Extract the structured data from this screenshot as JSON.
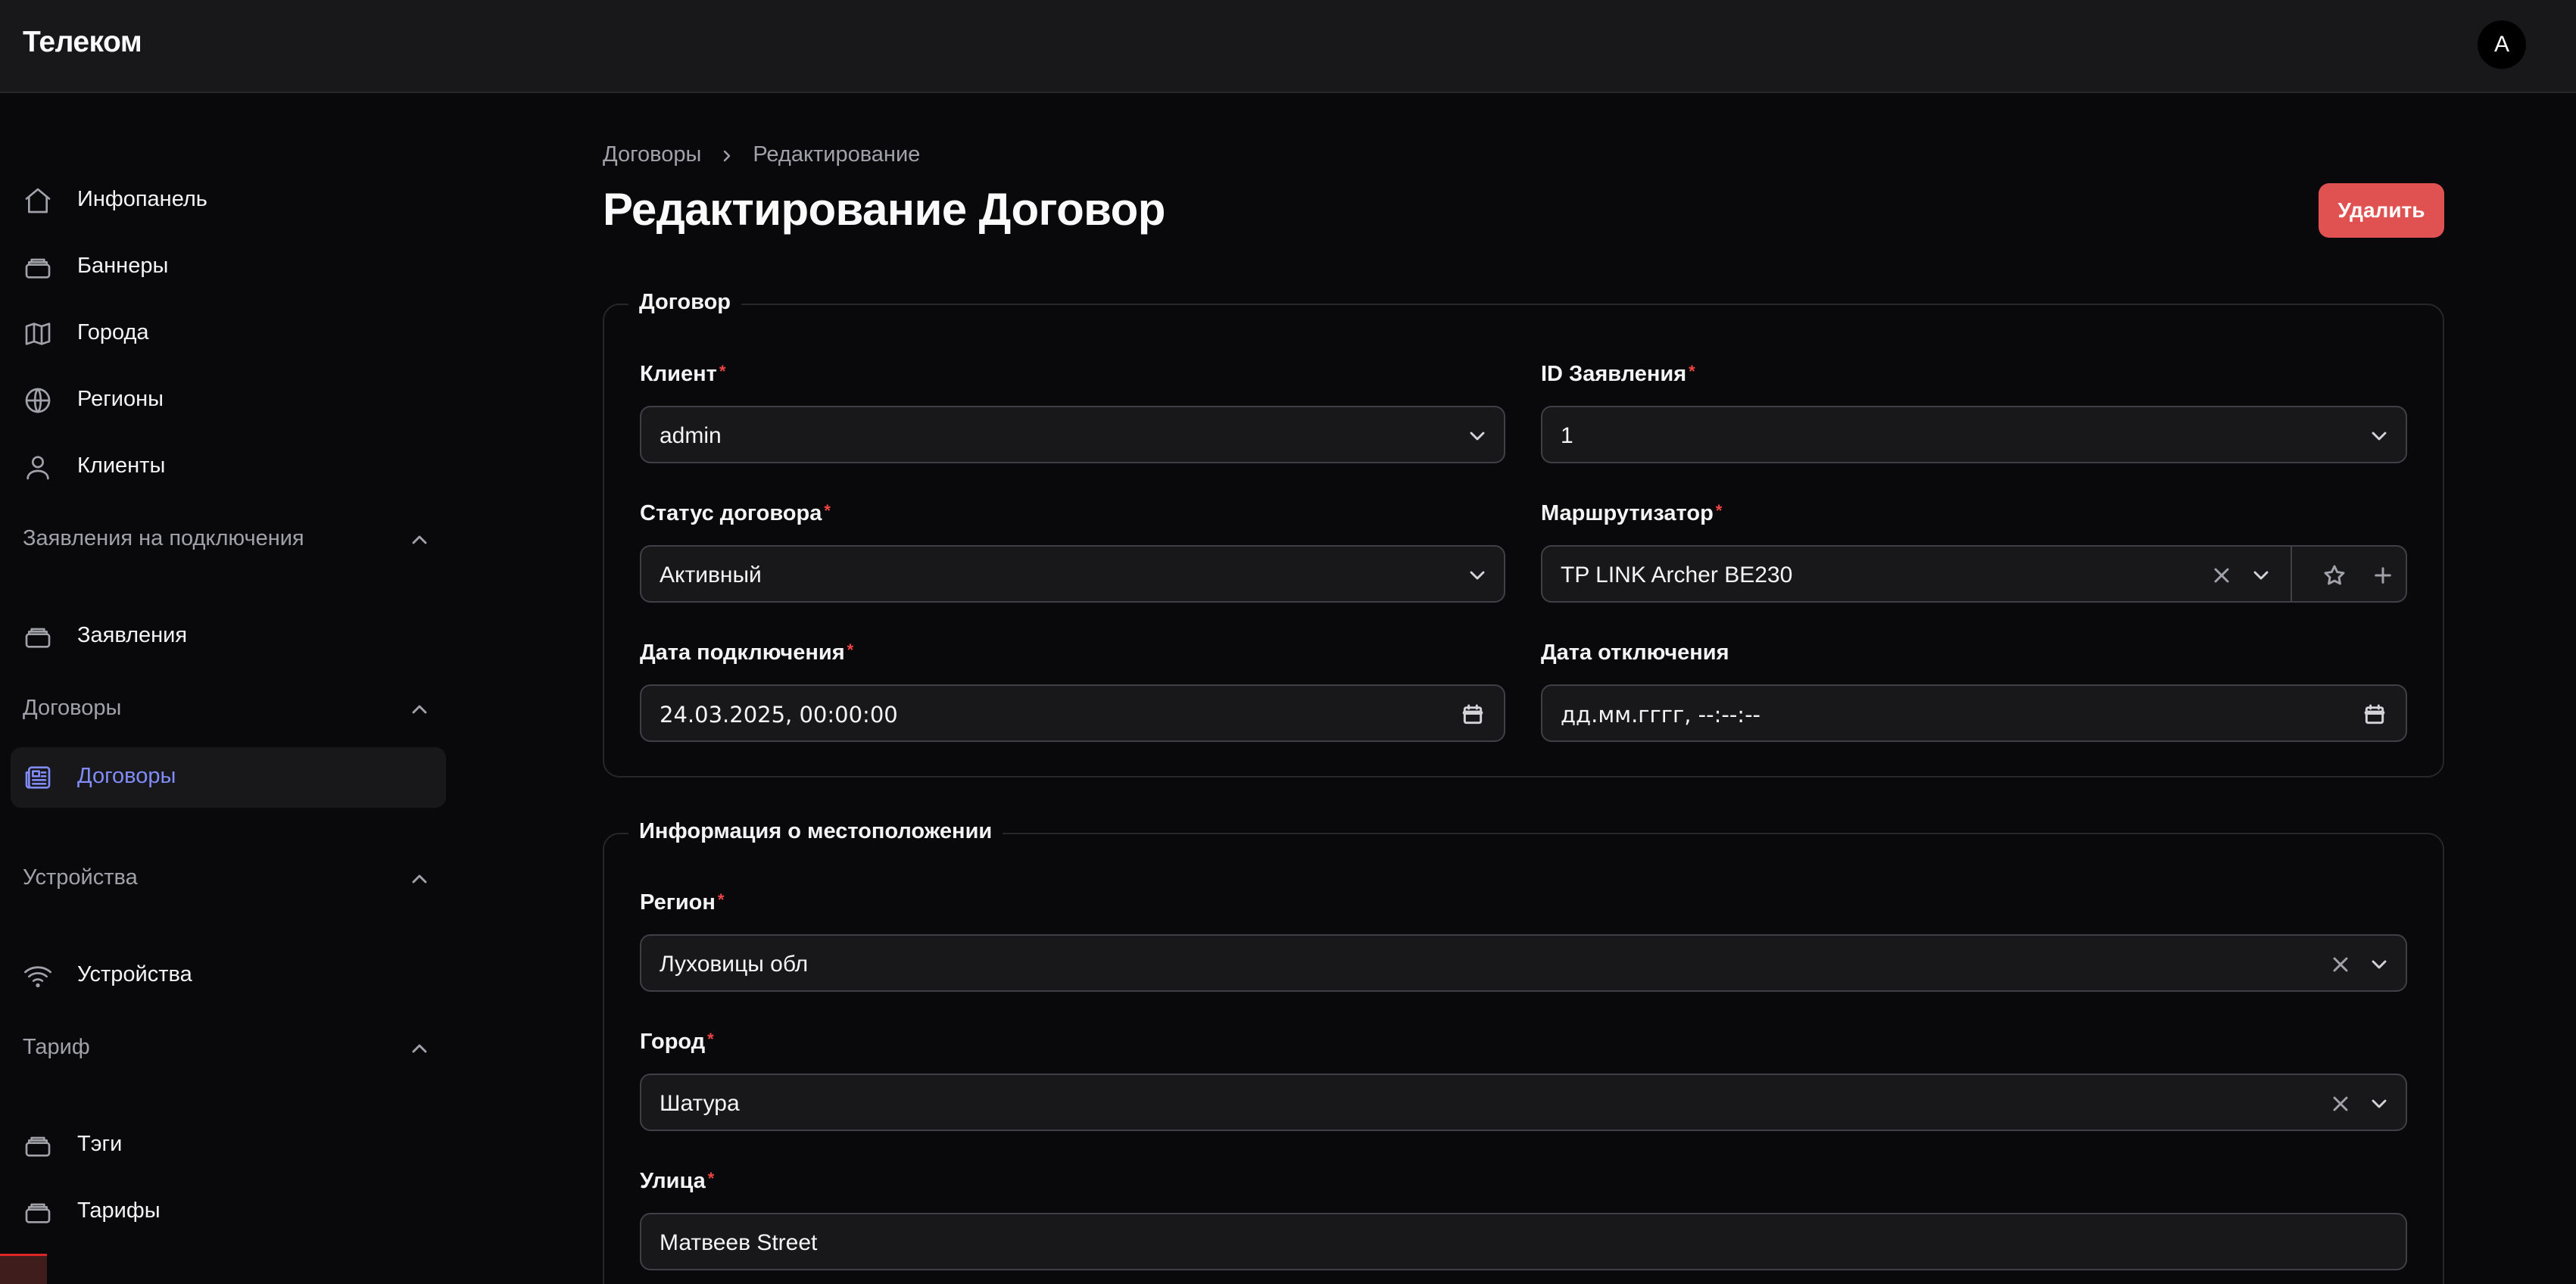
{
  "app": {
    "brand": "Телеком",
    "avatar_letter": "A"
  },
  "sidebar": {
    "items_top": [
      {
        "label": "Инфопанель",
        "icon": "home-icon"
      },
      {
        "label": "Баннеры",
        "icon": "stack-icon"
      },
      {
        "label": "Города",
        "icon": "map-icon"
      },
      {
        "label": "Регионы",
        "icon": "globe-icon"
      },
      {
        "label": "Клиенты",
        "icon": "user-icon"
      }
    ],
    "groups": [
      {
        "title": "Заявления на подключения",
        "items": [
          {
            "label": "Заявления",
            "icon": "stack-icon"
          }
        ]
      },
      {
        "title": "Договоры",
        "items": [
          {
            "label": "Договоры",
            "icon": "newspaper-icon",
            "active": true
          }
        ]
      },
      {
        "title": "Устройства",
        "items": [
          {
            "label": "Устройства",
            "icon": "wifi-icon"
          }
        ]
      },
      {
        "title": "Тариф",
        "items": [
          {
            "label": "Тэги",
            "icon": "stack-icon"
          },
          {
            "label": "Тарифы",
            "icon": "stack-icon"
          }
        ]
      }
    ]
  },
  "breadcrumb": {
    "parent": "Договоры",
    "current": "Редактирование"
  },
  "page": {
    "title": "Редактирование Договор",
    "delete_label": "Удалить"
  },
  "contract_section": {
    "legend": "Договор",
    "fields": {
      "client": {
        "label": "Клиент",
        "value": "admin"
      },
      "application_id": {
        "label": "ID Заявления",
        "value": "1"
      },
      "status": {
        "label": "Статус договора",
        "value": "Активный"
      },
      "router": {
        "label": "Маршрутизатор",
        "value": "TP LINK Archer BE230"
      },
      "connect_date": {
        "label": "Дата подключения",
        "value": "24.03.2025, 00:00:00"
      },
      "disconnect_date": {
        "label": "Дата отключения",
        "value": "дд.мм.гггг, --:--:--"
      }
    }
  },
  "location_section": {
    "legend": "Информация о местоположении",
    "fields": {
      "region": {
        "label": "Регион",
        "value": "Луховицы обл"
      },
      "city": {
        "label": "Город",
        "value": "Шатура"
      },
      "street": {
        "label": "Улица",
        "value": "Матвеев Street"
      }
    }
  },
  "required_mark": "*",
  "colors": {
    "accent": "#818cf8",
    "danger": "#e05252",
    "required": "#ef4444"
  }
}
